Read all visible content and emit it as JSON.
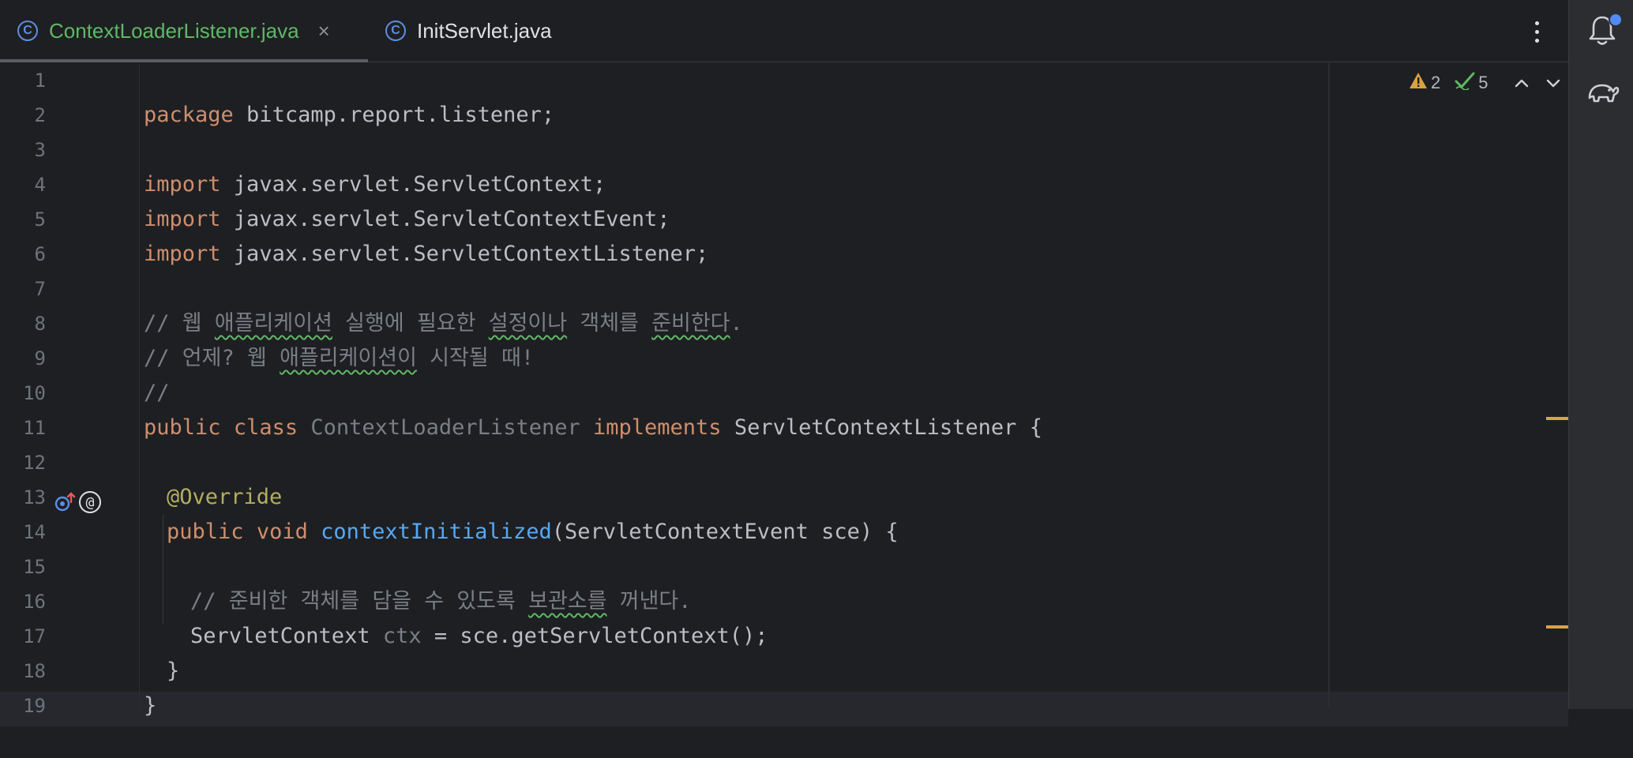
{
  "tabs": [
    {
      "label": "ContextLoaderListener.java",
      "icon": "class-icon",
      "active": true
    },
    {
      "label": "InitServlet.java",
      "icon": "class-icon",
      "active": false
    }
  ],
  "tab_close_glyph": "×",
  "inspection": {
    "warnings": "2",
    "checks": "5"
  },
  "gutter_glyphs": {
    "at": "@",
    "class": "C"
  },
  "colors": {
    "background": "#1e1f22",
    "keyword": "#cf8e6d",
    "comment": "#7a7e85",
    "annotation": "#b3ae60",
    "function": "#56a8f5",
    "active_tab_text": "#5fb865",
    "warning": "#d9a343"
  },
  "code": {
    "line_numbers": [
      "1",
      "2",
      "3",
      "4",
      "5",
      "6",
      "7",
      "8",
      "9",
      "10",
      "11",
      "12",
      "13",
      "14",
      "15",
      "16",
      "17",
      "18",
      "19"
    ],
    "l1_kw": "package",
    "l1_rest": " bitcamp.report.listener;",
    "l3_kw": "import",
    "l3_rest": " javax.servlet.ServletContext;",
    "l4_kw": "import",
    "l4_rest": " javax.servlet.ServletContextEvent;",
    "l5_kw": "import",
    "l5_rest": " javax.servlet.ServletContextListener;",
    "l7_a": "// 웹 ",
    "l7_b": "애플리케이션",
    "l7_c": " 실행에 필요한 ",
    "l7_d": "설정이나",
    "l7_e": " 객체를 ",
    "l7_f": "준비한다",
    "l7_g": ".",
    "l8_a": "// 언제? 웹 ",
    "l8_b": "애플리케이션이",
    "l8_c": " 시작될 때!",
    "l9": "//",
    "l10_kw1": "public",
    "l10_kw2": "class",
    "l10_name": "ContextLoaderListener",
    "l10_kw3": "implements",
    "l10_rest": " ServletContextListener {",
    "l12": "@Override",
    "l13_kw1": "public",
    "l13_kw2": "void",
    "l13_fn": "contextInitialized",
    "l13_rest": "(ServletContextEvent sce) {",
    "l15_a": "// 준비한 객체를 담을 수 있도록 ",
    "l15_b": "보관소를",
    "l15_c": " 꺼낸다.",
    "l16_a": "ServletContext ",
    "l16_b": "ctx",
    "l16_c": " = sce.getServletContext();",
    "l17": "}",
    "l18": "}"
  }
}
